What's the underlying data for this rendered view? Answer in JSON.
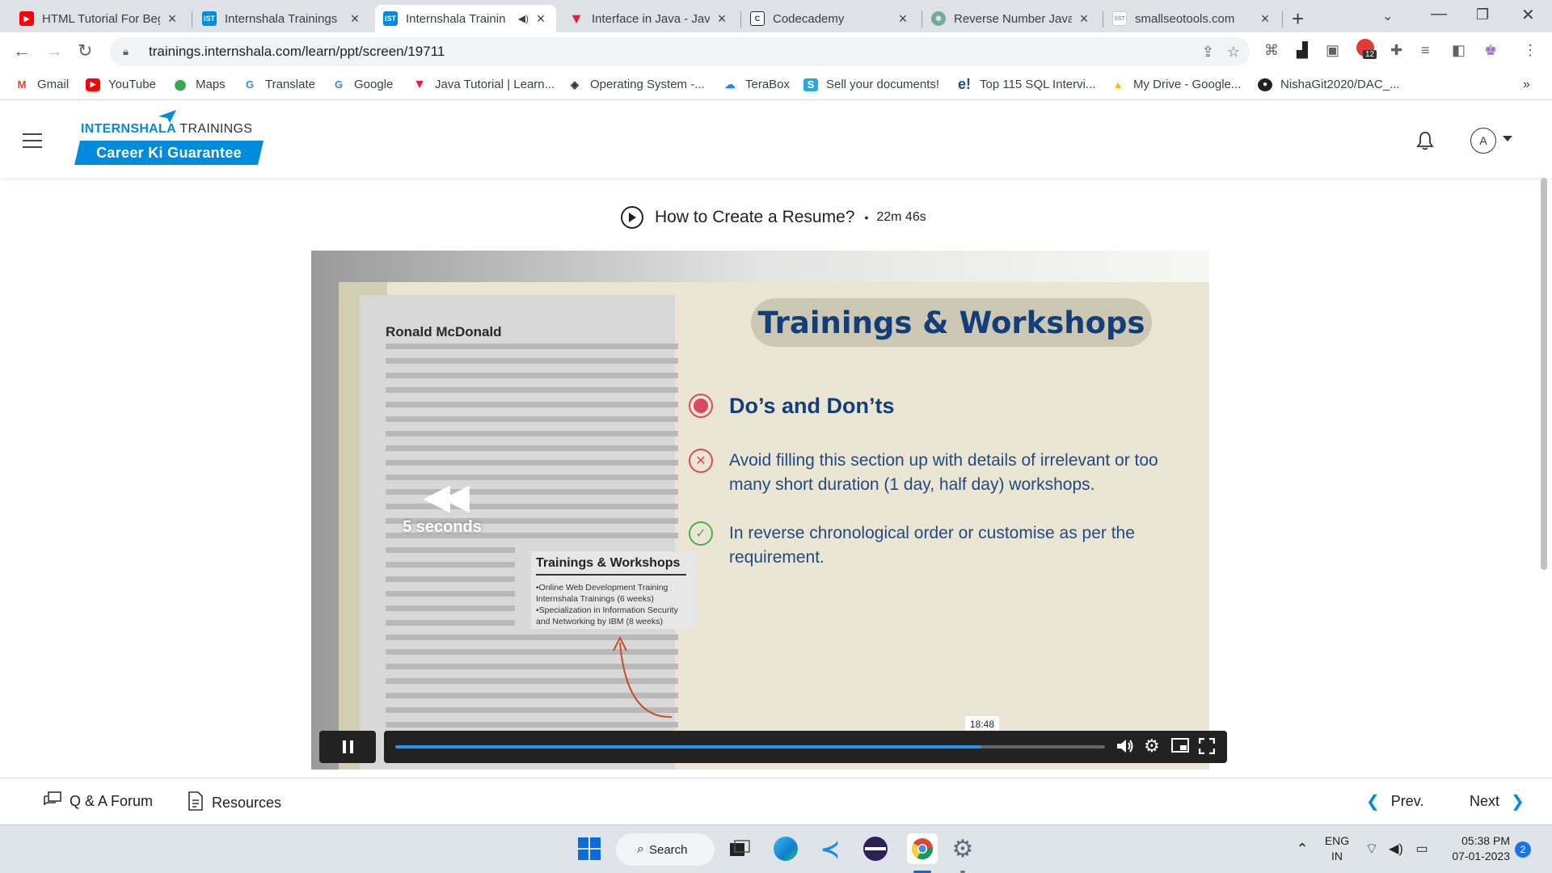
{
  "browser": {
    "tabs": [
      {
        "title": "HTML Tutorial For Beg",
        "favicon": "youtube-icon",
        "color": "#ff0000"
      },
      {
        "title": "Internshala Trainings",
        "favicon": "ist-icon",
        "color": "#008bdc"
      },
      {
        "title": "Internshala Trainin",
        "favicon": "ist-icon",
        "color": "#008bdc",
        "active": true
      },
      {
        "title": "Interface in Java - Java",
        "favicon": "javatpoint-icon",
        "color": "#e91e3c"
      },
      {
        "title": "Codecademy",
        "favicon": "codecademy-icon",
        "color": "#1f2a44"
      },
      {
        "title": "Reverse Number Java",
        "favicon": "chatgpt-icon",
        "color": "#74aa9c"
      },
      {
        "title": "smallseotools.com",
        "favicon": "sst-icon",
        "color": "#999999"
      }
    ],
    "url": "trainings.internshala.com/learn/ppt/screen/19711",
    "bookmarks": [
      {
        "label": "Gmail",
        "icon": "gmail-icon"
      },
      {
        "label": "YouTube",
        "icon": "youtube-icon"
      },
      {
        "label": "Maps",
        "icon": "maps-icon"
      },
      {
        "label": "Translate",
        "icon": "translate-icon"
      },
      {
        "label": "Google",
        "icon": "google-icon"
      },
      {
        "label": "Java Tutorial | Learn...",
        "icon": "javatpoint-icon"
      },
      {
        "label": "Operating System -...",
        "icon": "os-icon"
      },
      {
        "label": "TeraBox",
        "icon": "terabox-icon"
      },
      {
        "label": "Sell your documents!",
        "icon": "sell-icon"
      },
      {
        "label": "Top 115 SQL Intervi...",
        "icon": "edureka-icon"
      },
      {
        "label": "My Drive - Google...",
        "icon": "drive-icon"
      },
      {
        "label": "NishaGit2020/DAC_...",
        "icon": "github-icon"
      }
    ],
    "ext_badge": "12",
    "more_bookmarks": "»"
  },
  "site": {
    "logo_brand": "INTERNSHALA",
    "logo_suffix": " TRAININGS",
    "logo_tagline": "Career Ki Guarantee",
    "avatar_letter": "A",
    "brand_color": "#008bdc"
  },
  "lesson": {
    "title": "How to Create a Resume?",
    "separator": "•",
    "duration": "22m 46s"
  },
  "slide": {
    "resume_name": "Ronald McDonald",
    "resume_box_title": "Trainings & Workshops",
    "resume_box_text": "•Online Web Development Training\n Internshala Trainings (6 weeks)\n•Specialization in Information Security\n and Networking by IBM (8 weeks)",
    "heading": "Trainings & Workshops",
    "bullet_head": "Do’s and Don’ts",
    "dont_text": "Avoid filling this section up with details of irrelevant or too many short duration (1 day, half day) workshops.",
    "do_text": "In reverse chronological order or customise as per the requirement."
  },
  "player": {
    "rewind_label": "5 seconds",
    "current_time_tip": "18:48",
    "progress_fraction": 0.826
  },
  "footer": {
    "qa_label": "Q & A Forum",
    "resources_label": "Resources",
    "prev_label": "Prev.",
    "next_label": "Next"
  },
  "taskbar": {
    "search_label": "Search",
    "lang_line1": "ENG",
    "lang_line2": "IN",
    "time": "05:38 PM",
    "date": "07-01-2023",
    "notifications": "2"
  }
}
